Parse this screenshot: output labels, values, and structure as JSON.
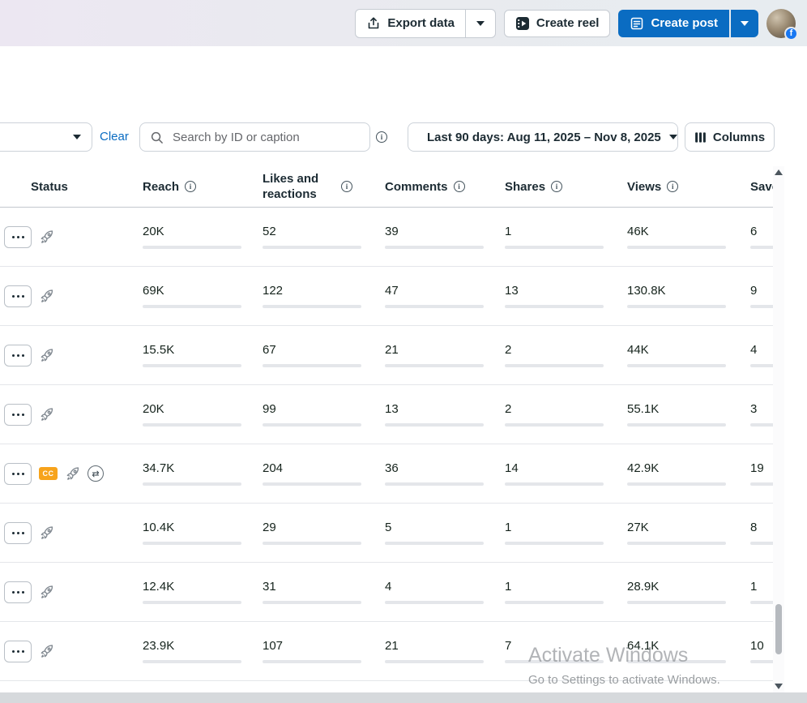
{
  "topbar": {
    "export_button": {
      "label": "Export data"
    },
    "create_reel_button": {
      "label": "Create reel"
    },
    "create_post_button": {
      "label": "Create post"
    }
  },
  "filters": {
    "clear_label": "Clear",
    "search": {
      "placeholder": "Search by ID or caption"
    },
    "date_range": {
      "label": "Last 90 days: Aug 11, 2025 – Nov 8, 2025"
    },
    "columns_button": {
      "label": "Columns"
    }
  },
  "table": {
    "cc_badge_label": "CC",
    "columns": [
      {
        "key": "status",
        "label": "Status"
      },
      {
        "key": "reach",
        "label": "Reach",
        "max": 69000
      },
      {
        "key": "likes",
        "label": "Likes and reactions",
        "max": 204
      },
      {
        "key": "comments",
        "label": "Comments",
        "max": 47
      },
      {
        "key": "shares",
        "label": "Shares",
        "max": 14
      },
      {
        "key": "views",
        "label": "Views",
        "max": 130800
      },
      {
        "key": "saves",
        "label": "Saves",
        "max": 19
      }
    ],
    "rows": [
      {
        "badges": [],
        "reach": {
          "text": "20K",
          "value": 20000
        },
        "likes": {
          "text": "52",
          "value": 52
        },
        "comments": {
          "text": "39",
          "value": 39
        },
        "shares": {
          "text": "1",
          "value": 1
        },
        "views": {
          "text": "46K",
          "value": 46000
        },
        "saves": {
          "text": "6",
          "value": 6
        }
      },
      {
        "badges": [],
        "reach": {
          "text": "69K",
          "value": 69000
        },
        "likes": {
          "text": "122",
          "value": 122
        },
        "comments": {
          "text": "47",
          "value": 47
        },
        "shares": {
          "text": "13",
          "value": 13
        },
        "views": {
          "text": "130.8K",
          "value": 130800
        },
        "saves": {
          "text": "9",
          "value": 9
        }
      },
      {
        "badges": [],
        "reach": {
          "text": "15.5K",
          "value": 15500
        },
        "likes": {
          "text": "67",
          "value": 67
        },
        "comments": {
          "text": "21",
          "value": 21
        },
        "shares": {
          "text": "2",
          "value": 2
        },
        "views": {
          "text": "44K",
          "value": 44000
        },
        "saves": {
          "text": "4",
          "value": 4
        }
      },
      {
        "badges": [],
        "reach": {
          "text": "20K",
          "value": 20000
        },
        "likes": {
          "text": "99",
          "value": 99
        },
        "comments": {
          "text": "13",
          "value": 13
        },
        "shares": {
          "text": "2",
          "value": 2
        },
        "views": {
          "text": "55.1K",
          "value": 55100
        },
        "saves": {
          "text": "3",
          "value": 3
        }
      },
      {
        "badges": [
          "cc",
          "crosspost"
        ],
        "reach": {
          "text": "34.7K",
          "value": 34700
        },
        "likes": {
          "text": "204",
          "value": 204
        },
        "comments": {
          "text": "36",
          "value": 36
        },
        "shares": {
          "text": "14",
          "value": 14
        },
        "views": {
          "text": "42.9K",
          "value": 42900
        },
        "saves": {
          "text": "19",
          "value": 19
        }
      },
      {
        "badges": [],
        "reach": {
          "text": "10.4K",
          "value": 10400
        },
        "likes": {
          "text": "29",
          "value": 29
        },
        "comments": {
          "text": "5",
          "value": 5
        },
        "shares": {
          "text": "1",
          "value": 1
        },
        "views": {
          "text": "27K",
          "value": 27000
        },
        "saves": {
          "text": "8",
          "value": 8
        }
      },
      {
        "badges": [],
        "reach": {
          "text": "12.4K",
          "value": 12400
        },
        "likes": {
          "text": "31",
          "value": 31
        },
        "comments": {
          "text": "4",
          "value": 4
        },
        "shares": {
          "text": "1",
          "value": 1
        },
        "views": {
          "text": "28.9K",
          "value": 28900
        },
        "saves": {
          "text": "1",
          "value": 1
        }
      },
      {
        "badges": [],
        "reach": {
          "text": "23.9K",
          "value": 23900
        },
        "likes": {
          "text": "107",
          "value": 107
        },
        "comments": {
          "text": "21",
          "value": 21
        },
        "shares": {
          "text": "7",
          "value": 7
        },
        "views": {
          "text": "64.1K",
          "value": 64100
        },
        "saves": {
          "text": "10",
          "value": 10
        }
      }
    ]
  },
  "watermark": {
    "line1": "Activate Windows",
    "line2": "Go to Settings to activate Windows."
  },
  "icons": {
    "crosspost_glyph": "⇄",
    "facebook_badge_glyph": "f",
    "info_glyph": "i"
  },
  "colors": {
    "accent_blue": "#0a6cc2",
    "bar_fill": "#14593a",
    "bar_track": "#e4e6ea",
    "cc_badge": "#f7a31b"
  }
}
